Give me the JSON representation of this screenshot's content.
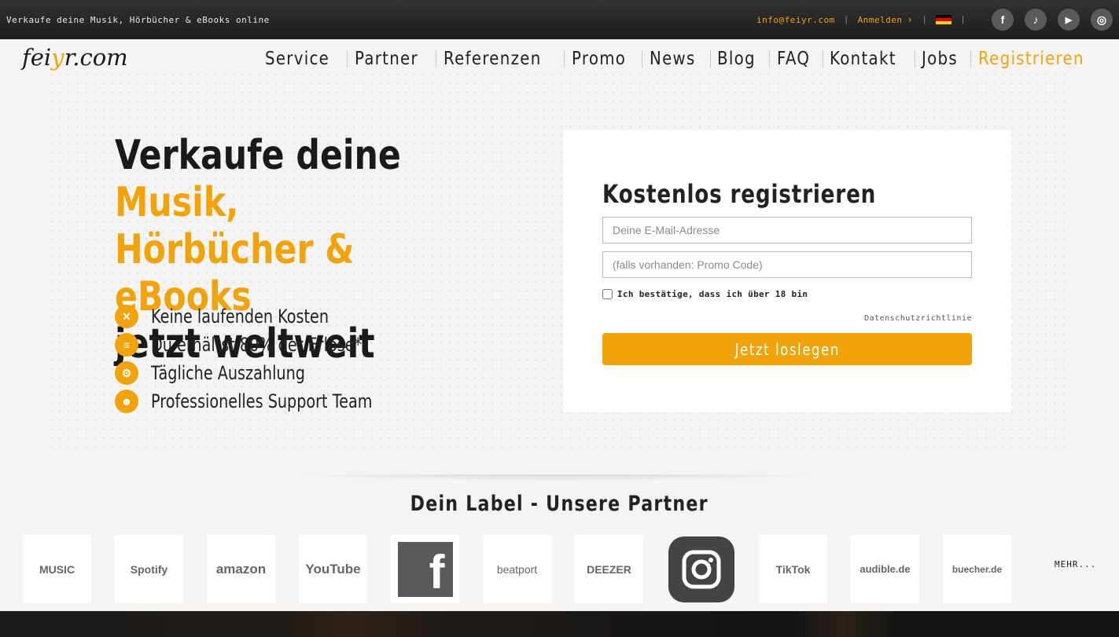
{
  "topbar": {
    "tagline": "Verkaufe deine Musik, Hörbücher & eBooks online",
    "email": "info@feiyr.com",
    "login": "Anmelden",
    "social": [
      {
        "icon": "facebook-icon",
        "glyph": "f"
      },
      {
        "icon": "tiktok-icon",
        "glyph": "♪"
      },
      {
        "icon": "youtube-icon",
        "glyph": "▶"
      },
      {
        "icon": "instagram-icon",
        "glyph": "◎"
      }
    ]
  },
  "logo": {
    "text_a": "fei",
    "text_o": "y",
    "text_b": "r.com"
  },
  "nav": {
    "items": [
      "Service",
      "Partner",
      "Referenzen",
      "Promo",
      "News",
      "Blog",
      "FAQ",
      "Kontakt",
      "Jobs"
    ],
    "register": "Registrieren"
  },
  "hero": {
    "line1_dark": "Verkaufe deine ",
    "line1_orange": "Musik,",
    "line2_orange": "Hörbücher & eBooks",
    "line3_dark": "jetzt weltweit",
    "features": [
      {
        "icon": "cross-circle-icon",
        "glyph": "✕",
        "text": "Keine laufenden Kosten"
      },
      {
        "icon": "coins-icon",
        "glyph": "≡",
        "text": "Du erhältst 80% der Erlöse*"
      },
      {
        "icon": "gears-icon",
        "glyph": "⚙",
        "text": "Tägliche Auszahlung"
      },
      {
        "icon": "team-icon",
        "glyph": "☻",
        "text": "Professionelles Support Team"
      }
    ]
  },
  "form": {
    "title": "Kostenlos registrieren",
    "email_placeholder": "Deine E-Mail-Adresse",
    "promo_placeholder": "(falls vorhanden: Promo Code)",
    "age_label": "Ich bestätige, dass ich über 18 bin",
    "privacy": "Datenschutzrichtlinie",
    "submit": "Jetzt loslegen"
  },
  "partners": {
    "title": "Dein Label - Unsere Partner",
    "items": [
      {
        "name": "apple-music-logo",
        "label": " MUSIC"
      },
      {
        "name": "spotify-logo",
        "label": "Spotify"
      },
      {
        "name": "amazon-logo",
        "label": "amazon"
      },
      {
        "name": "youtube-logo",
        "label": "YouTube"
      },
      {
        "name": "facebook-logo",
        "label": "f"
      },
      {
        "name": "beatport-logo",
        "label": "beatport"
      },
      {
        "name": "deezer-logo",
        "label": "DEEZER"
      },
      {
        "name": "instagram-logo",
        "label": ""
      },
      {
        "name": "tiktok-logo",
        "label": "TikTok"
      },
      {
        "name": "audible-logo",
        "label": "audible.de"
      },
      {
        "name": "buecher-logo",
        "label": "buecher.de"
      }
    ],
    "more": "MEHR..."
  },
  "colors": {
    "accent": "#f0a30a",
    "topbar": "#222222",
    "text": "#222222"
  }
}
